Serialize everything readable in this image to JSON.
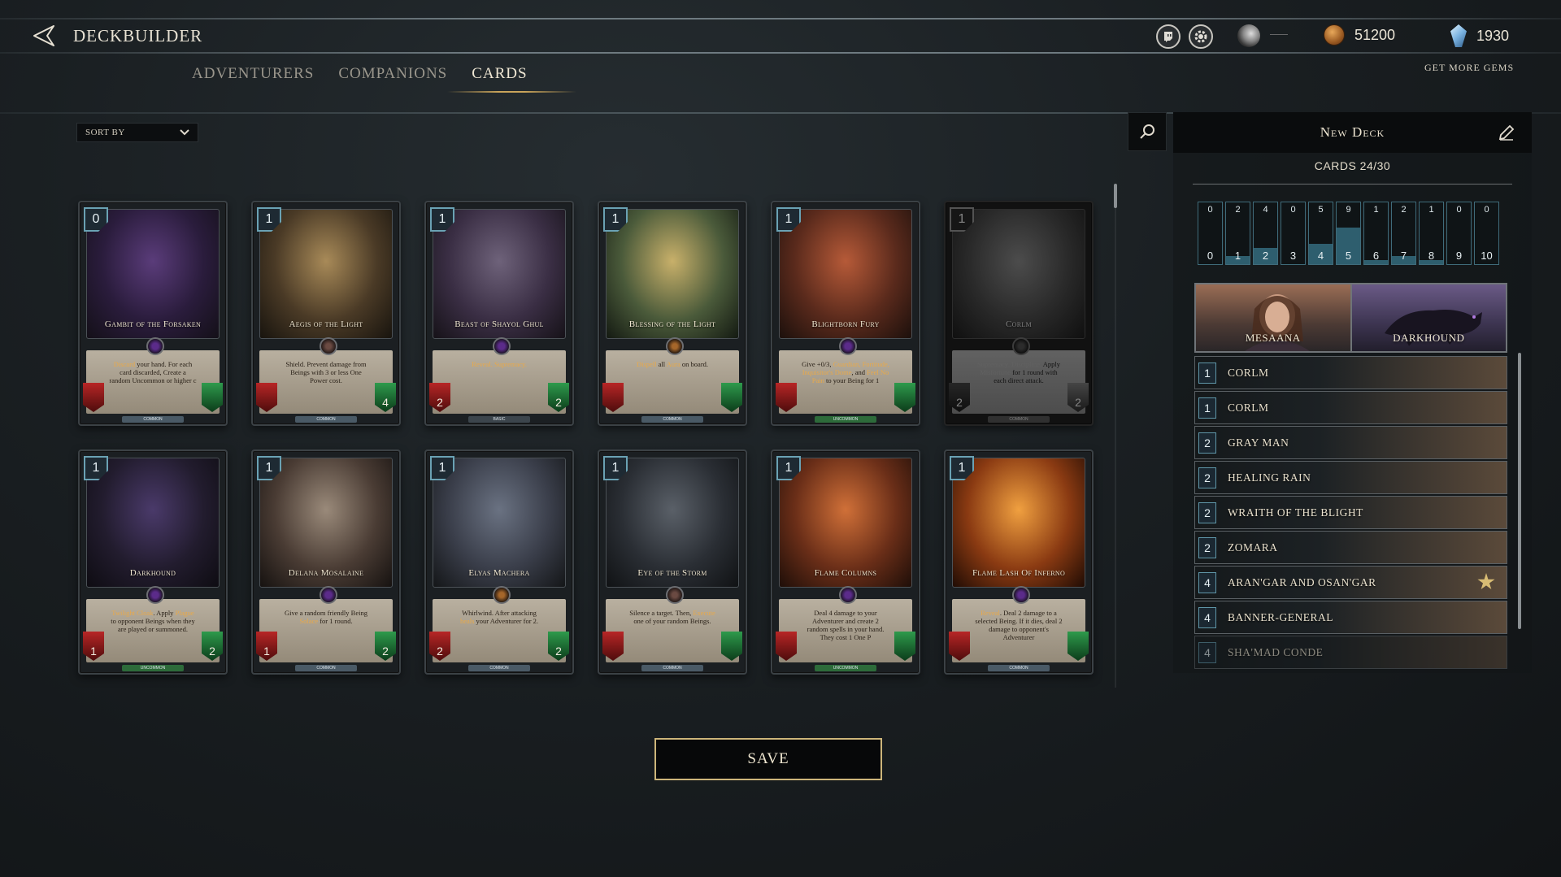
{
  "header": {
    "title": "DECKBUILDER",
    "tabs": [
      {
        "label": "ADVENTURERS",
        "active": false
      },
      {
        "label": "COMPANIONS",
        "active": false
      },
      {
        "label": "CARDS",
        "active": true
      }
    ],
    "coins": "51200",
    "gems": "1930",
    "get_more_gems": "GET MORE GEMS",
    "icons": [
      "back-arrow-icon",
      "twitch-icon",
      "settings-gear-icon",
      "moon-icon",
      "coin-icon",
      "gem-icon"
    ]
  },
  "sort": {
    "label": "SORT BY"
  },
  "cards": [
    {
      "name": "Gambit of the Forsaken",
      "cost": "0",
      "attack": "",
      "health": "",
      "rarity": "COMMON",
      "gem": "purple",
      "desc": [
        {
          "t": "Discard",
          "h": true
        },
        {
          "t": " your hand. For each card discarded, Create a random Uncommon or higher c",
          "h": false
        }
      ],
      "art": [
        "#5a3c7a",
        "#2a1c3c",
        "#141018"
      ],
      "dim": false
    },
    {
      "name": "Aegis of the Light",
      "cost": "1",
      "attack": "",
      "health": "4",
      "rarity": "COMMON",
      "gem": "dark",
      "desc": [
        {
          "t": "Shield. Prevent damage from Beings with 3 or less One Power cost.",
          "h": false
        }
      ],
      "art": [
        "#a88a58",
        "#4a3a26",
        "#18140e"
      ],
      "dim": false
    },
    {
      "name": "Beast of Shayol Ghul",
      "cost": "1",
      "attack": "2",
      "health": "2",
      "rarity": "BASIC",
      "gem": "purple",
      "desc": [
        {
          "t": "Reveal. Supremacy.",
          "h": true
        }
      ],
      "art": [
        "#6e627a",
        "#3a2e44",
        "#161218"
      ],
      "dim": false
    },
    {
      "name": "Blessing of the Light",
      "cost": "1",
      "attack": "",
      "health": "",
      "rarity": "COMMON",
      "gem": "orange",
      "desc": [
        {
          "t": "Dispell",
          "h": true
        },
        {
          "t": " all ",
          "h": false
        },
        {
          "t": "Aura",
          "h": true
        },
        {
          "t": " on board.",
          "h": false
        }
      ],
      "art": [
        "#c8b06a",
        "#4a5a3a",
        "#141a12"
      ],
      "dim": false
    },
    {
      "name": "Blightborn Fury",
      "cost": "1",
      "attack": "",
      "health": "",
      "rarity": "UNCOMMON",
      "gem": "purple",
      "desc": [
        {
          "t": "Give +0/3, ",
          "h": false
        },
        {
          "t": "Guardian, Fortitude, Inquisitor's Dome",
          "h": true
        },
        {
          "t": ", and ",
          "h": false
        },
        {
          "t": "Feel No Pain",
          "h": true
        },
        {
          "t": " to your Being for 1",
          "h": false
        }
      ],
      "art": [
        "#b65a38",
        "#5a2a1c",
        "#1c100c"
      ],
      "dim": false
    },
    {
      "name": "Corlm",
      "cost": "1",
      "attack": "2",
      "health": "2",
      "rarity": "COMMON",
      "gem": "dark",
      "desc": [
        {
          "t": "Supremacy. Discipline.",
          "h": true
        },
        {
          "t": " Apply ",
          "h": false
        },
        {
          "t": "Misfortune",
          "h": true
        },
        {
          "t": " for 1 round with each direct attack.",
          "h": false
        }
      ],
      "art": [
        "#8a8a8a",
        "#4a4a4a",
        "#1c1c1c"
      ],
      "dim": true
    },
    {
      "name": "Darkhound",
      "cost": "1",
      "attack": "1",
      "health": "2",
      "rarity": "UNCOMMON",
      "gem": "purple",
      "desc": [
        {
          "t": "Twilight Cloak",
          "h": true
        },
        {
          "t": ". Apply ",
          "h": false
        },
        {
          "t": "Plague",
          "h": true
        },
        {
          "t": " to opponent Beings when they are played or summoned.",
          "h": false
        }
      ],
      "art": [
        "#4a3a6a",
        "#221c2e",
        "#0e0c12"
      ],
      "dim": false
    },
    {
      "name": "Delana Mosalaine",
      "cost": "1",
      "attack": "1",
      "health": "2",
      "rarity": "COMMON",
      "gem": "purple",
      "desc": [
        {
          "t": "Give a random friendly Being ",
          "h": false
        },
        {
          "t": "Solace",
          "h": true
        },
        {
          "t": " for 1 round.",
          "h": false
        }
      ],
      "art": [
        "#9a8a7a",
        "#4a3c34",
        "#161210"
      ],
      "dim": false
    },
    {
      "name": "Elyas Machera",
      "cost": "1",
      "attack": "2",
      "health": "2",
      "rarity": "COMMON",
      "gem": "orange",
      "desc": [
        {
          "t": "Whirlwind. After attacking ",
          "h": false
        },
        {
          "t": "heals",
          "h": true
        },
        {
          "t": " your Adventurer for 2.",
          "h": false
        }
      ],
      "art": [
        "#6a7282",
        "#3a3e4a",
        "#141618"
      ],
      "dim": false
    },
    {
      "name": "Eye of the Storm",
      "cost": "1",
      "attack": "",
      "health": "",
      "rarity": "COMMON",
      "gem": "dark",
      "desc": [
        {
          "t": "Silence a target. Then, ",
          "h": false
        },
        {
          "t": "Execute",
          "h": true
        },
        {
          "t": " one of your random Beings.",
          "h": false
        }
      ],
      "art": [
        "#5a6068",
        "#2a2e34",
        "#101214"
      ],
      "dim": false
    },
    {
      "name": "Flame Columns",
      "cost": "1",
      "attack": "",
      "health": "",
      "rarity": "UNCOMMON",
      "gem": "purple",
      "desc": [
        {
          "t": "Deal 4 damage to your Adventurer and create 2 random spells in your hand. They cost 1 One P",
          "h": false
        }
      ],
      "art": [
        "#d07038",
        "#6a2e18",
        "#1e0e08"
      ],
      "dim": false
    },
    {
      "name": "Flame Lash Of Inferno",
      "cost": "1",
      "attack": "",
      "health": "",
      "rarity": "COMMON",
      "gem": "purple",
      "desc": [
        {
          "t": "Reveal",
          "h": true
        },
        {
          "t": ". Deal 2 damage to a selected Being. If it dies, deal 2 damage to opponent's Adventurer",
          "h": false
        }
      ],
      "art": [
        "#f0a040",
        "#8a3a12",
        "#200c04"
      ],
      "dim": false
    }
  ],
  "deck": {
    "name": "New Deck",
    "count_label": "CARDS 24/30",
    "curve": [
      {
        "cost": "0",
        "count": 0
      },
      {
        "cost": "1",
        "count": 2
      },
      {
        "cost": "2",
        "count": 4
      },
      {
        "cost": "3",
        "count": 0
      },
      {
        "cost": "4",
        "count": 5
      },
      {
        "cost": "5",
        "count": 9
      },
      {
        "cost": "6",
        "count": 1
      },
      {
        "cost": "7",
        "count": 2
      },
      {
        "cost": "8",
        "count": 1
      },
      {
        "cost": "9",
        "count": 0
      },
      {
        "cost": "10",
        "count": 0
      }
    ],
    "heroes": [
      {
        "name": "MESAANA"
      },
      {
        "name": "DARKHOUND"
      }
    ],
    "list": [
      {
        "cost": "1",
        "name": "CORLM",
        "star": false,
        "faded": false
      },
      {
        "cost": "1",
        "name": "CORLM",
        "star": false,
        "faded": false
      },
      {
        "cost": "2",
        "name": "GRAY MAN",
        "star": false,
        "faded": false
      },
      {
        "cost": "2",
        "name": "HEALING RAIN",
        "star": false,
        "faded": false
      },
      {
        "cost": "2",
        "name": "WRAITH OF THE BLIGHT",
        "star": false,
        "faded": false
      },
      {
        "cost": "2",
        "name": "ZOMARA",
        "star": false,
        "faded": false
      },
      {
        "cost": "4",
        "name": "ARAN'GAR AND OSAN'GAR",
        "star": true,
        "faded": false
      },
      {
        "cost": "4",
        "name": "BANNER-GENERAL",
        "star": false,
        "faded": false
      },
      {
        "cost": "4",
        "name": "SHA'MAD CONDE",
        "star": false,
        "faded": true
      }
    ]
  },
  "save_label": "SAVE",
  "colors": {
    "accent_gold": "#c9a45a",
    "cost_blue": "#6aa2b4",
    "bg": "#14181b"
  }
}
